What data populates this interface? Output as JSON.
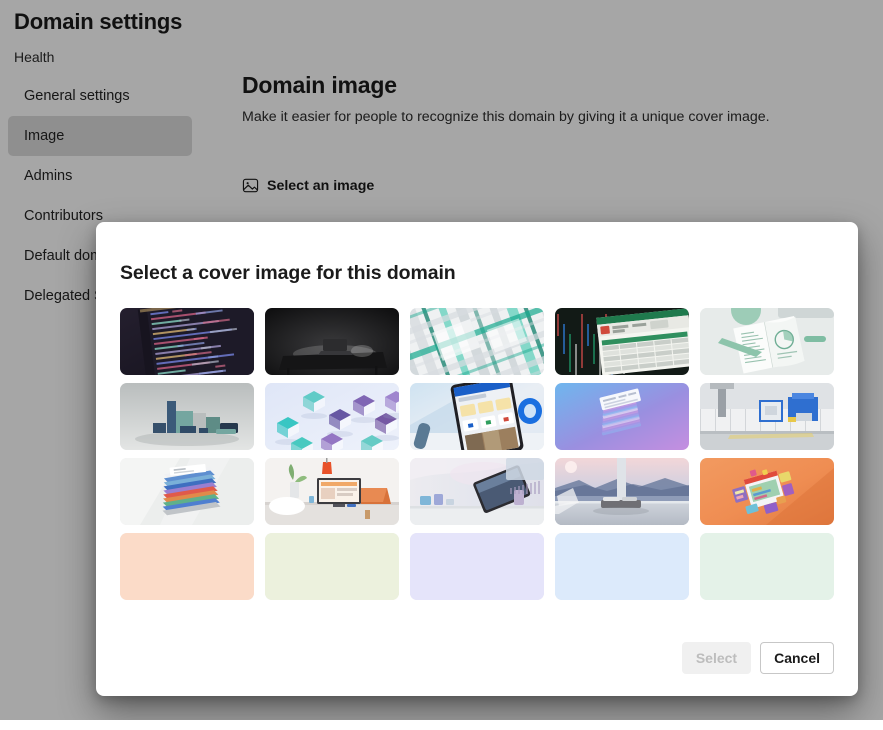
{
  "page": {
    "title": "Domain settings",
    "subtitle": "Health"
  },
  "sidebar": {
    "items": [
      {
        "label": "General settings",
        "selected": false
      },
      {
        "label": "Image",
        "selected": true
      },
      {
        "label": "Admins",
        "selected": false
      },
      {
        "label": "Contributors",
        "selected": false
      },
      {
        "label": "Default domain",
        "selected": false
      },
      {
        "label": "Delegated Settings",
        "selected": false
      }
    ]
  },
  "main": {
    "section_title": "Domain image",
    "section_desc": "Make it easier for people to recognize this domain by giving it a unique cover image.",
    "select_image_label": "Select an image",
    "select_image_icon": "image-icon"
  },
  "modal": {
    "title": "Select a cover image for this domain",
    "select_button": {
      "label": "Select",
      "disabled": true
    },
    "cancel_button": {
      "label": "Cancel",
      "disabled": false
    },
    "thumbnails": [
      {
        "id": "code-editor-dark",
        "alt": "Dark code editor on a laptop screen",
        "kind": "photo"
      },
      {
        "id": "laptop-dark-desk",
        "alt": "Laptop glowing on a dark desk",
        "kind": "photo"
      },
      {
        "id": "abstract-green-grid",
        "alt": "Abstract white and green circuit grid",
        "kind": "photo"
      },
      {
        "id": "spreadsheet-screens",
        "alt": "Spreadsheet app on screens in a dark room",
        "kind": "photo"
      },
      {
        "id": "notebook-charts",
        "alt": "Open notebook with charts on a desk",
        "kind": "photo"
      },
      {
        "id": "teal-blocks",
        "alt": "Teal and grey 3D blocks",
        "kind": "photo"
      },
      {
        "id": "glass-cubes",
        "alt": "Purple and teal glass cubes",
        "kind": "photo"
      },
      {
        "id": "phone-blue-app",
        "alt": "Phone displaying a blue app interface",
        "kind": "photo"
      },
      {
        "id": "stacked-cards-purple",
        "alt": "Stack of twisted cards on purple gradient",
        "kind": "photo"
      },
      {
        "id": "office-printer",
        "alt": "Blue printer in a light office",
        "kind": "photo"
      },
      {
        "id": "colorful-papers",
        "alt": "Stack of colorful papers",
        "kind": "photo"
      },
      {
        "id": "desk-workspace",
        "alt": "Tidy desk with monitor, plant and lamp",
        "kind": "photo"
      },
      {
        "id": "tablet-pastel",
        "alt": "Tablet floating over pastel desk",
        "kind": "photo"
      },
      {
        "id": "window-landscape",
        "alt": "Sofa by a window with mountain view",
        "kind": "photo"
      },
      {
        "id": "orange-app-isometric",
        "alt": "Isometric app illustration on orange",
        "kind": "photo"
      },
      {
        "id": "solid-peach",
        "alt": "Solid peach color",
        "kind": "solid",
        "color": "#fbdbc8"
      },
      {
        "id": "solid-lime",
        "alt": "Solid pale lime color",
        "kind": "solid",
        "color": "#ecf1dd"
      },
      {
        "id": "solid-lavender",
        "alt": "Solid lavender color",
        "kind": "solid",
        "color": "#e5e4fa"
      },
      {
        "id": "solid-sky",
        "alt": "Solid sky blue color",
        "kind": "solid",
        "color": "#dceafb"
      },
      {
        "id": "solid-mint",
        "alt": "Solid mint green color",
        "kind": "solid",
        "color": "#e4f2e8"
      }
    ]
  },
  "colors": {
    "page_background": "#ffffff",
    "sidebar_selected": "#dcdcdc",
    "modal_background": "#ffffff",
    "scrim": "rgba(0,0,0,0.35)"
  }
}
